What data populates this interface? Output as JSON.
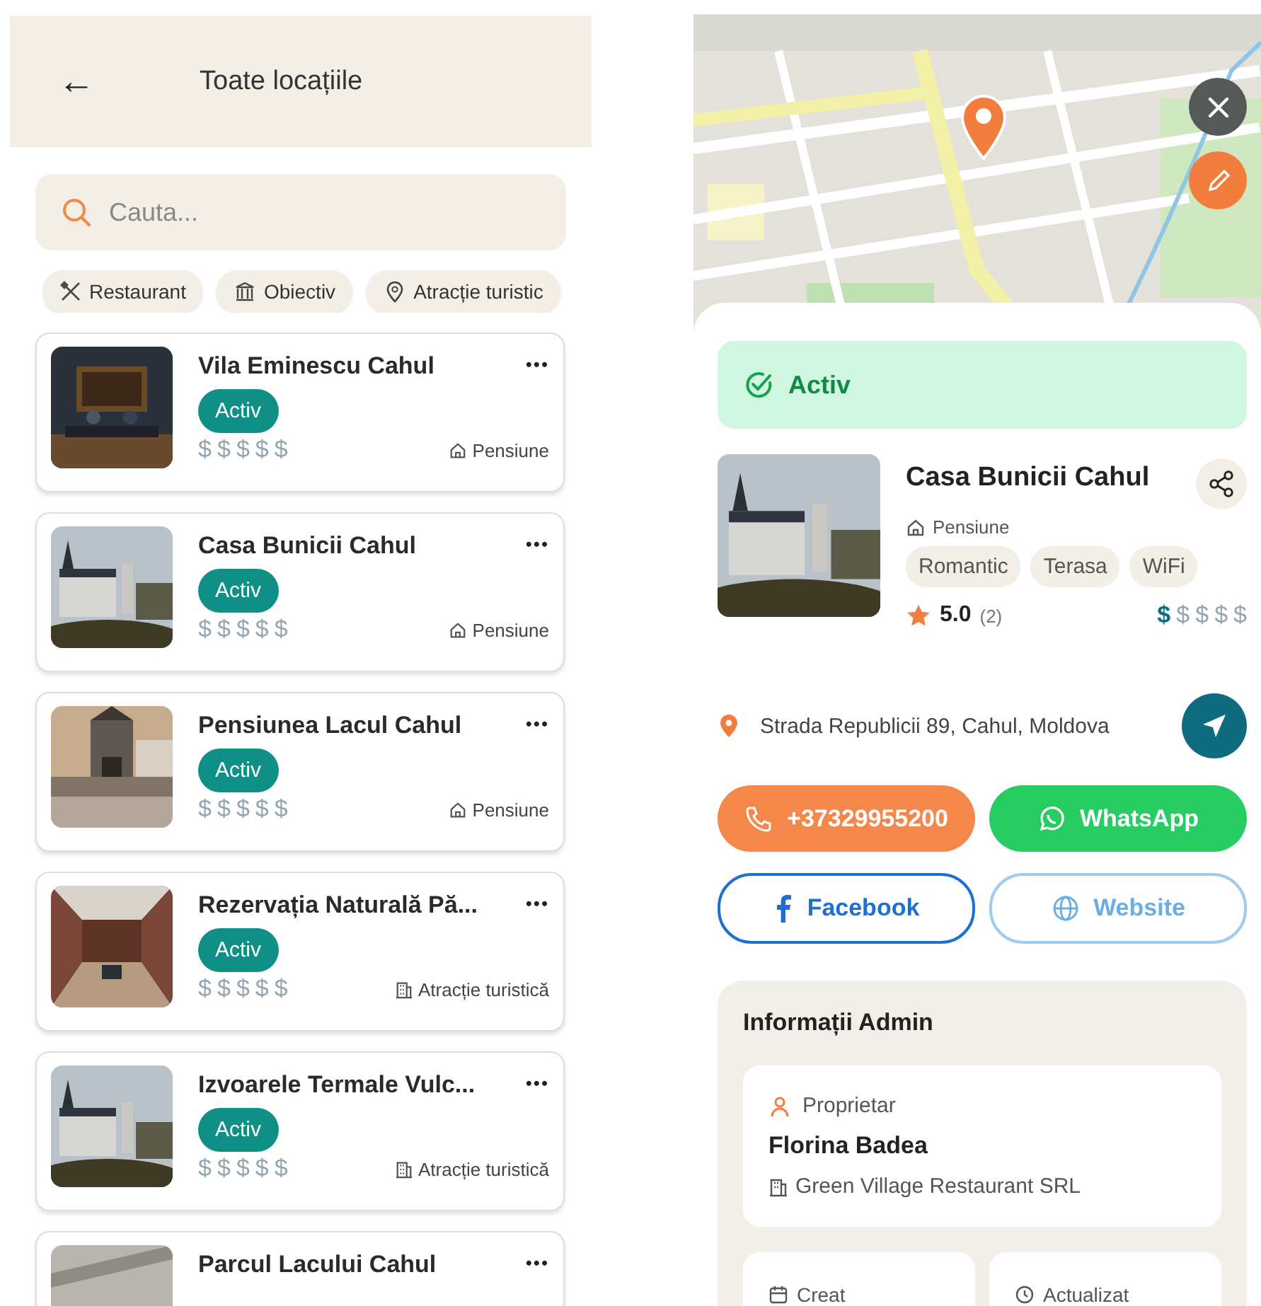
{
  "list_screen": {
    "header": {
      "back": "←",
      "title": "Toate locațiile"
    },
    "search": {
      "placeholder": "Cauta..."
    },
    "filters": [
      {
        "label": "Restaurant",
        "selected": false
      },
      {
        "label": "Obiectiv",
        "selected": false
      },
      {
        "label": "Atracție turistic",
        "selected": false
      }
    ],
    "locations": [
      {
        "name": "Vila Eminescu Cahul",
        "status": "Activ",
        "active": true,
        "price": [
          {
            "symbol": "$",
            "on": false
          },
          {
            "symbol": "$",
            "on": false
          },
          {
            "symbol": "$",
            "on": false
          },
          {
            "symbol": "$",
            "on": false
          },
          {
            "symbol": "$",
            "on": false
          }
        ],
        "category": "Pensiune",
        "menu": "•••"
      },
      {
        "name": "Casa Bunicii Cahul",
        "status": "Activ",
        "active": true,
        "price": [
          {
            "symbol": "$",
            "on": false
          },
          {
            "symbol": "$",
            "on": false
          },
          {
            "symbol": "$",
            "on": false
          },
          {
            "symbol": "$",
            "on": false
          },
          {
            "symbol": "$",
            "on": false
          }
        ],
        "category": "Pensiune",
        "menu": "•••"
      },
      {
        "name": "Pensiunea Lacul Cahul",
        "status": "Activ",
        "active": true,
        "price": [
          {
            "symbol": "$",
            "on": false
          },
          {
            "symbol": "$",
            "on": false
          },
          {
            "symbol": "$",
            "on": false
          },
          {
            "symbol": "$",
            "on": false
          },
          {
            "symbol": "$",
            "on": false
          }
        ],
        "category": "Pensiune",
        "menu": "•••"
      },
      {
        "name": "Rezervația Naturală Pă...",
        "status": "Activ",
        "active": true,
        "price": [
          {
            "symbol": "$",
            "on": false
          },
          {
            "symbol": "$",
            "on": false
          },
          {
            "symbol": "$",
            "on": false
          },
          {
            "symbol": "$",
            "on": false
          },
          {
            "symbol": "$",
            "on": false
          }
        ],
        "category": "Atracție turistică",
        "menu": "•••"
      },
      {
        "name": "Izvoarele Termale Vulc...",
        "status": "Activ",
        "active": true,
        "price": [
          {
            "symbol": "$",
            "on": false
          },
          {
            "symbol": "$",
            "on": false
          },
          {
            "symbol": "$",
            "on": false
          },
          {
            "symbol": "$",
            "on": false
          },
          {
            "symbol": "$",
            "on": false
          }
        ],
        "category": "Atracție turistică",
        "menu": "•••"
      },
      {
        "name": "Parcul Lacului Cahul",
        "menu": "•••"
      }
    ]
  },
  "detail_screen": {
    "status": {
      "label": "Activ",
      "active": true
    },
    "name": "Casa Bunicii Cahul",
    "category": "Pensiune",
    "tags": [
      "Romantic",
      "Terasa",
      "WiFi"
    ],
    "rating": "5.0",
    "reviews": "(2)",
    "price": [
      {
        "symbol": "$",
        "on": true
      },
      {
        "symbol": "$",
        "on": false
      },
      {
        "symbol": "$",
        "on": false
      },
      {
        "symbol": "$",
        "on": false
      },
      {
        "symbol": "$",
        "on": false
      }
    ],
    "address": "Strada Republicii 89, Cahul, Moldova",
    "buttons": [
      {
        "label": "+37329955200",
        "kind": "phone"
      },
      {
        "label": "WhatsApp",
        "kind": "whatsapp"
      },
      {
        "label": "Facebook",
        "kind": "facebook"
      },
      {
        "label": "Website",
        "kind": "website"
      }
    ],
    "admin": {
      "title": "Informații Admin",
      "owner_label": "Proprietar",
      "owner_name": "Florina Badea",
      "company": "Green Village Restaurant SRL",
      "created_label": "Creat",
      "updated_label": "Actualizat"
    }
  }
}
